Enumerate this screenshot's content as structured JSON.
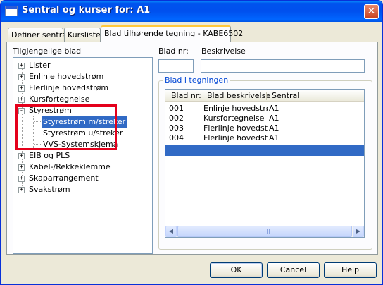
{
  "window": {
    "title": "Sentral og kurser for: A1",
    "close_glyph": "✕"
  },
  "tabs": [
    {
      "label": "Definer sentral"
    },
    {
      "label": "Kursliste"
    },
    {
      "label": "Blad tilhørende tegning - KABE6502"
    }
  ],
  "left": {
    "label": "Tilgjengelige blad",
    "tree": [
      {
        "label": "Lister",
        "expander": "+"
      },
      {
        "label": "Enlinje hovedstrøm",
        "expander": "+"
      },
      {
        "label": "Flerlinje hovedstrøm",
        "expander": "+"
      },
      {
        "label": "Kursfortegnelse",
        "expander": "+"
      },
      {
        "label": "Styrestrøm",
        "expander": "-"
      },
      {
        "label": "Styrestrøm m/streker"
      },
      {
        "label": "Styrestrøm u/streker"
      },
      {
        "label": "VVS-Systemskjema"
      },
      {
        "label": "EIB og PLS",
        "expander": "+"
      },
      {
        "label": "Kabel-/Rekkeklemme",
        "expander": "+"
      },
      {
        "label": "Skaparrangement",
        "expander": "+"
      },
      {
        "label": "Svakstrøm",
        "expander": "+"
      }
    ]
  },
  "right": {
    "blad_nr_label": "Blad nr:",
    "blad_nr_value": "",
    "beskrivelse_label": "Beskrivelse",
    "beskrivelse_value": "",
    "group_label": "Blad i tegningen",
    "columns": [
      "Blad nr:",
      "Blad beskrivelse",
      "Sentral"
    ],
    "rows": [
      [
        "001",
        "Enlinje hovedstrøm",
        "A1"
      ],
      [
        "002",
        "Kursfortegnelse",
        "A1"
      ],
      [
        "003",
        "Flerlinje hovedstr...",
        "A1"
      ],
      [
        "004",
        "Flerlinje hovedstr...",
        "A1"
      ]
    ]
  },
  "buttons": {
    "ok": "OK",
    "cancel": "Cancel",
    "help": "Help"
  },
  "colors": {
    "selection": "#316ac5",
    "highlight_box": "#e4001b",
    "titlebar": "#0054e3"
  },
  "icons": {
    "scroll_left": "◀",
    "scroll_right": "▶"
  }
}
